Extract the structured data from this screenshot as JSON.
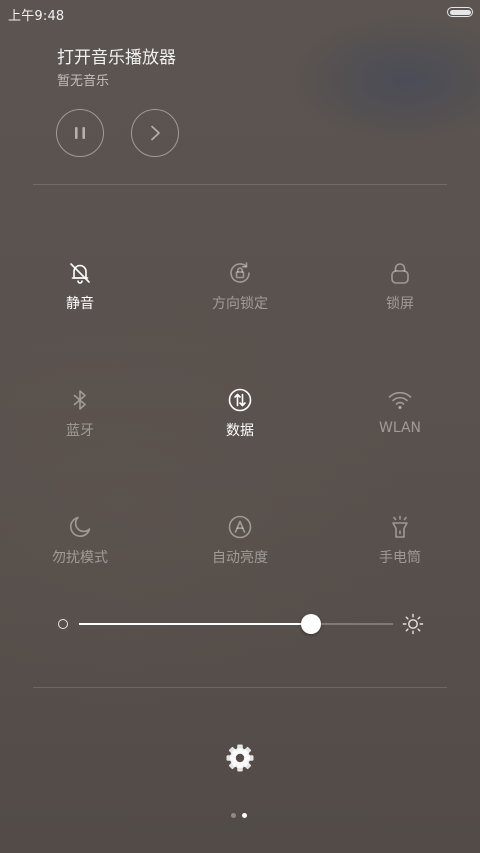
{
  "status_bar": {
    "time": "上午9:48",
    "battery_level": 1.0
  },
  "music": {
    "title": "打开音乐播放器",
    "subtitle": "暂无音乐",
    "pause_icon": "pause-icon",
    "next_icon": "chevron-right-icon"
  },
  "toggles": [
    {
      "label": "静音",
      "icon": "bell-off-icon",
      "active": true
    },
    {
      "label": "方向锁定",
      "icon": "rotation-lock-icon",
      "active": false
    },
    {
      "label": "锁屏",
      "icon": "lock-icon",
      "active": false
    },
    {
      "label": "蓝牙",
      "icon": "bluetooth-icon",
      "active": false
    },
    {
      "label": "数据",
      "icon": "mobile-data-icon",
      "active": true
    },
    {
      "label": "WLAN",
      "icon": "wifi-icon",
      "active": false
    },
    {
      "label": "勿扰模式",
      "icon": "moon-icon",
      "active": false
    },
    {
      "label": "自动亮度",
      "icon": "auto-brightness-icon",
      "active": false
    },
    {
      "label": "手电筒",
      "icon": "flashlight-icon",
      "active": false
    }
  ],
  "brightness": {
    "level": 0.74
  },
  "settings": {
    "icon": "gear-icon"
  },
  "pager": {
    "count": 2,
    "active_index": 1
  },
  "colors": {
    "active_text": "#ffffff",
    "inactive_text": "rgba(255,255,255,0.42)",
    "background": "#5a524e"
  }
}
